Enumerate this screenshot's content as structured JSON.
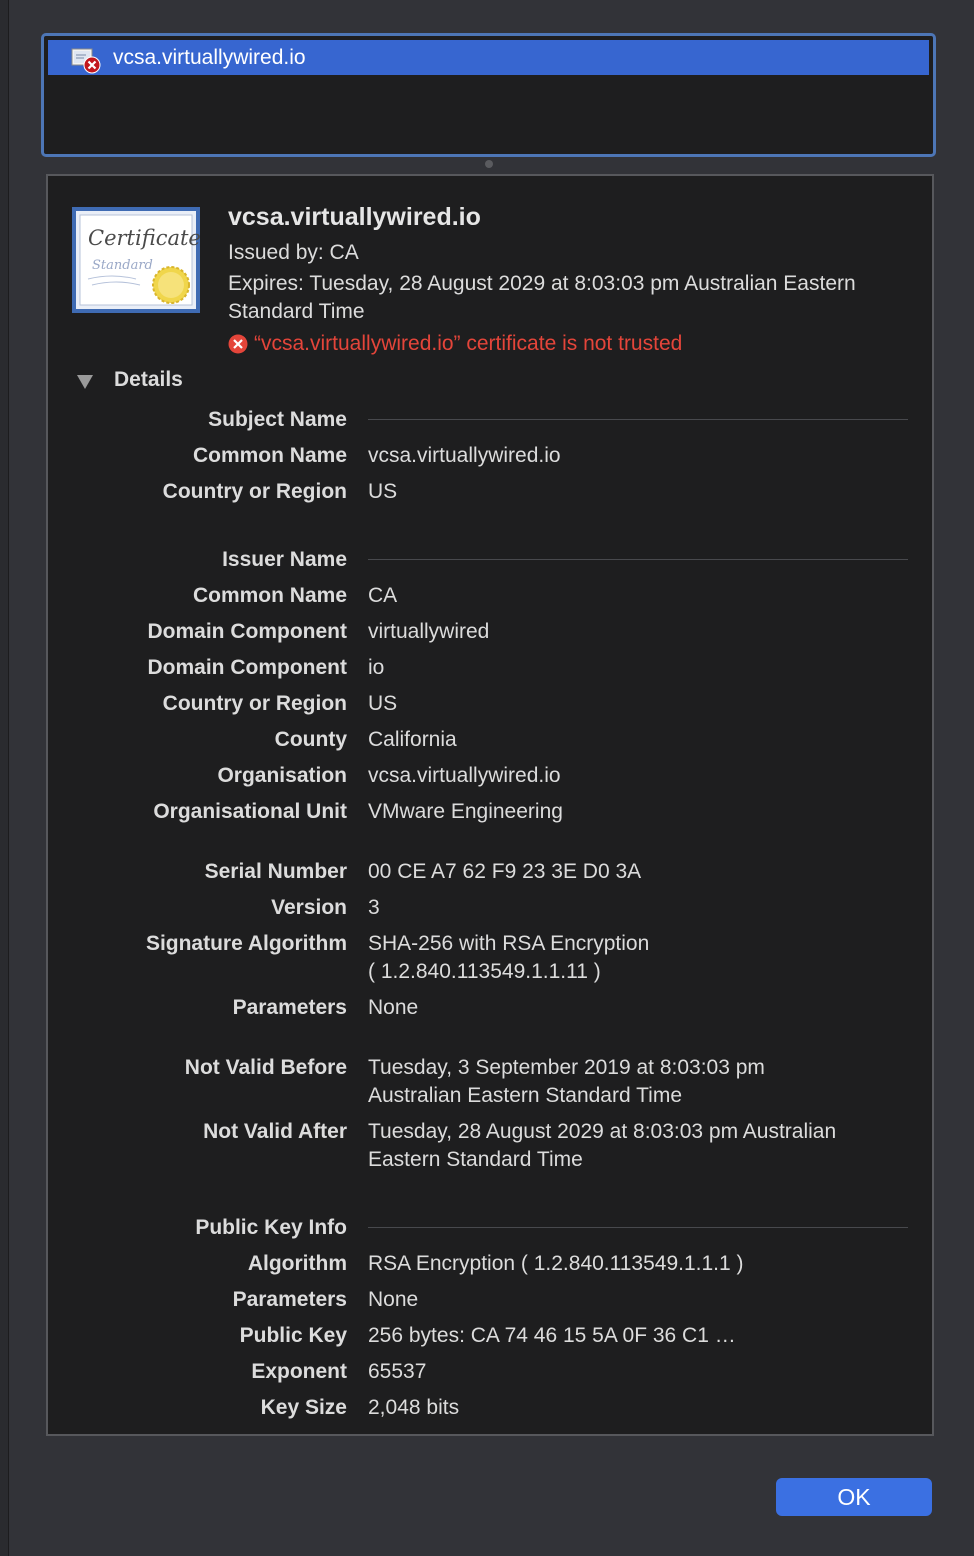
{
  "cert_list": {
    "selected_item": "vcsa.virtuallywired.io"
  },
  "header": {
    "title": "vcsa.virtuallywired.io",
    "issued_by": "Issued by: CA",
    "expires": "Expires: Tuesday, 28 August 2029 at 8:03:03 pm Australian Eastern Standard Time",
    "trust_warning": "“vcsa.virtuallywired.io” certificate is not trusted"
  },
  "details": {
    "label": "Details",
    "subject_name": {
      "heading": "Subject Name",
      "rows": [
        {
          "label": "Common Name",
          "value": "vcsa.virtuallywired.io"
        },
        {
          "label": "Country or Region",
          "value": "US"
        }
      ]
    },
    "issuer_name": {
      "heading": "Issuer Name",
      "rows": [
        {
          "label": "Common Name",
          "value": "CA"
        },
        {
          "label": "Domain Component",
          "value": "virtuallywired"
        },
        {
          "label": "Domain Component",
          "value": "io"
        },
        {
          "label": "Country or Region",
          "value": "US"
        },
        {
          "label": "County",
          "value": "California"
        },
        {
          "label": "Organisation",
          "value": "vcsa.virtuallywired.io"
        },
        {
          "label": "Organisational Unit",
          "value": "VMware Engineering"
        }
      ]
    },
    "general": {
      "rows": [
        {
          "label": "Serial Number",
          "value": "00 CE A7 62 F9 23 3E D0 3A"
        },
        {
          "label": "Version",
          "value": "3"
        },
        {
          "label": "Signature Algorithm",
          "value": "SHA-256 with RSA Encryption",
          "value2": "( 1.2.840.113549.1.1.11 )"
        },
        {
          "label": "Parameters",
          "value": "None"
        }
      ]
    },
    "validity": {
      "rows": [
        {
          "label": "Not Valid Before",
          "value": "Tuesday, 3 September 2019 at 8:03:03 pm Australian Eastern Standard Time"
        },
        {
          "label": "Not Valid After",
          "value": "Tuesday, 28 August 2029 at 8:03:03 pm Australian Eastern Standard Time"
        }
      ]
    },
    "public_key_info": {
      "heading": "Public Key Info",
      "rows": [
        {
          "label": "Algorithm",
          "value": "RSA Encryption ( 1.2.840.113549.1.1.1 )"
        },
        {
          "label": "Parameters",
          "value": "None"
        },
        {
          "label": "Public Key",
          "value": "256 bytes: CA 74 46 15 5A 0F 36 C1 …"
        },
        {
          "label": "Exponent",
          "value": "65537"
        },
        {
          "label": "Key Size",
          "value": "2,048 bits"
        }
      ]
    }
  },
  "certificate_image": {
    "script_text": "Certificate",
    "sub_text": "Standard"
  },
  "buttons": {
    "ok": "OK"
  },
  "colors": {
    "selection": "#3766d0",
    "error": "#e4453a",
    "panel": "#1e1e1f",
    "ok_button": "#3b70e2"
  }
}
